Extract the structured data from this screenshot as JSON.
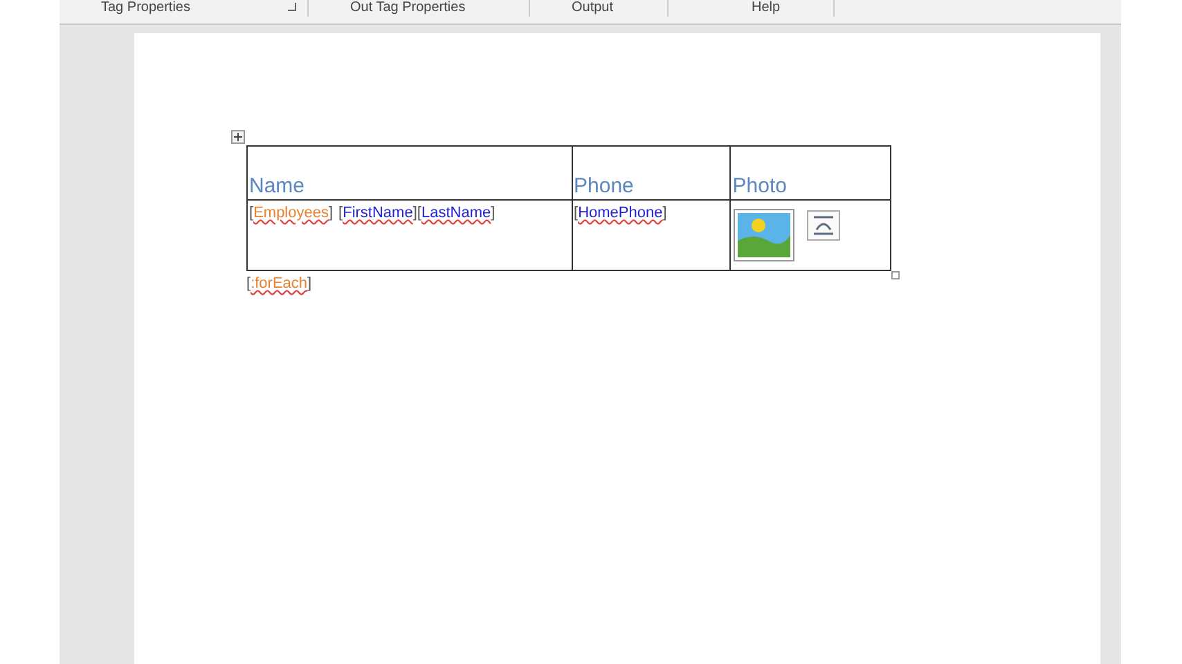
{
  "ribbon": {
    "groups": [
      {
        "label": "Tag Properties",
        "launcher": true
      },
      {
        "label": "Out Tag Properties",
        "launcher": false
      },
      {
        "label": "Output",
        "launcher": false
      },
      {
        "label": "Help",
        "launcher": false
      }
    ]
  },
  "table": {
    "columns": [
      "Name",
      "Phone",
      "Photo"
    ],
    "cells": [
      [
        {
          "kind": "tag",
          "open": "[",
          "name": "Employees",
          "close": "]",
          "color": "#e8802e"
        },
        {
          "kind": "tag",
          "open": "[",
          "name": "FirstName",
          "close": "]",
          "color": "#2222cc"
        },
        {
          "kind": "tag",
          "open": "[",
          "name": "LastName",
          "close": "]",
          "color": "#2222cc"
        }
      ],
      [
        {
          "kind": "tag",
          "open": "[",
          "name": "HomePhone",
          "close": "]",
          "color": "#2222cc"
        }
      ],
      [
        {
          "kind": "image",
          "selected": true
        }
      ]
    ]
  },
  "after_table": {
    "kind": "tag",
    "open": "[",
    "name": ":forEach",
    "close": "]",
    "color": "#e8802e"
  }
}
